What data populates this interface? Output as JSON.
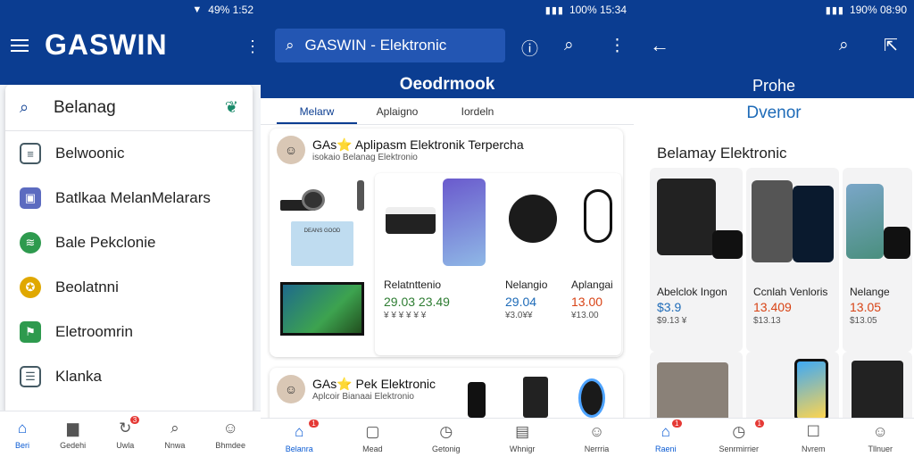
{
  "colors": {
    "primary": "#0b3d91",
    "accent": "#0b5bd3",
    "price_blue": "#1e6bb8",
    "price_red": "#d84315",
    "price_green": "#2e7d32"
  },
  "panel1": {
    "status_text": "49% 1:52",
    "brand": "GASWIN",
    "search_text": "Belanag",
    "menu": [
      {
        "label": "Belwoonic",
        "icon": "document-icon",
        "color": "#455a64"
      },
      {
        "label": "Batlkaa MelanMelarars",
        "icon": "wallet-icon",
        "color": "#5c6bc0"
      },
      {
        "label": "Bale Pekclonie",
        "icon": "spotify-icon",
        "color": "#2e9a4e"
      },
      {
        "label": "Beolatnni",
        "icon": "badge-icon",
        "color": "#e0a800"
      },
      {
        "label": "Eletroomrin",
        "icon": "flag-icon",
        "color": "#2e9a4e"
      },
      {
        "label": "Klanka",
        "icon": "list-icon",
        "color": "#455a64"
      }
    ],
    "nav": [
      {
        "label": "Beri",
        "icon": "home-icon",
        "active": true
      },
      {
        "label": "Gedehi",
        "icon": "bag-icon"
      },
      {
        "label": "Uwla",
        "icon": "refresh-icon",
        "badge": "3"
      },
      {
        "label": "Nnwa",
        "icon": "search-icon"
      },
      {
        "label": "Bhmdee",
        "icon": "user-icon"
      }
    ]
  },
  "panel2": {
    "status_text": "100% 15:34",
    "search_text": "GASWIN - Elektronic",
    "title": "Oeodrmook",
    "tabs": [
      "Melarw",
      "Aplaigno",
      "Iordeln"
    ],
    "card1": {
      "title": "GAs⭐ Aplipasm Elektronik Terpercha",
      "sub": "isokaio Belanag Elektronio",
      "box_text": "DEANS GOOD",
      "products": [
        {
          "name": "Relatnttenio",
          "price": "29.03 23.49",
          "old": "¥ ¥ ¥ ¥ ¥ ¥"
        },
        {
          "name": "Nelangio",
          "price": "29.04",
          "old": "¥3.0¥¥"
        },
        {
          "name": "Aplangai",
          "price": "13.00",
          "old": "¥13.00"
        }
      ]
    },
    "card2": {
      "title": "GAs⭐ Pek Elektronic",
      "sub": "Aplcoir Bianaai Elektronio"
    },
    "nav": [
      {
        "label": "Belanra",
        "icon": "home-icon",
        "active": true,
        "badge": "1"
      },
      {
        "label": "Mead",
        "icon": "tablet-icon"
      },
      {
        "label": "Getonig",
        "icon": "clock-icon"
      },
      {
        "label": "Whnigr",
        "icon": "book-icon"
      },
      {
        "label": "Nerrria",
        "icon": "user-icon"
      }
    ]
  },
  "panel3": {
    "status_text": "190% 08:90",
    "title": "Prohe",
    "subtitle": "Dvenor",
    "section": "Belamay Elektronic",
    "products": [
      {
        "name": "Abelclok Ingon",
        "price": "$3.9",
        "old": "$9.13 ¥"
      },
      {
        "name": "Ccnlah Venloris",
        "price": "13.409",
        "old": "$13.13"
      },
      {
        "name": "Nelange",
        "price": "13.05",
        "old": "$13.05"
      }
    ],
    "nav": [
      {
        "label": "Raeni",
        "icon": "home-icon",
        "active": true,
        "badge": "1"
      },
      {
        "label": "Senrmirrier",
        "icon": "clock-icon",
        "badge": "1"
      },
      {
        "label": "Nvrem",
        "icon": "chat-icon"
      },
      {
        "label": "Tllnuer",
        "icon": "user-icon"
      }
    ]
  }
}
